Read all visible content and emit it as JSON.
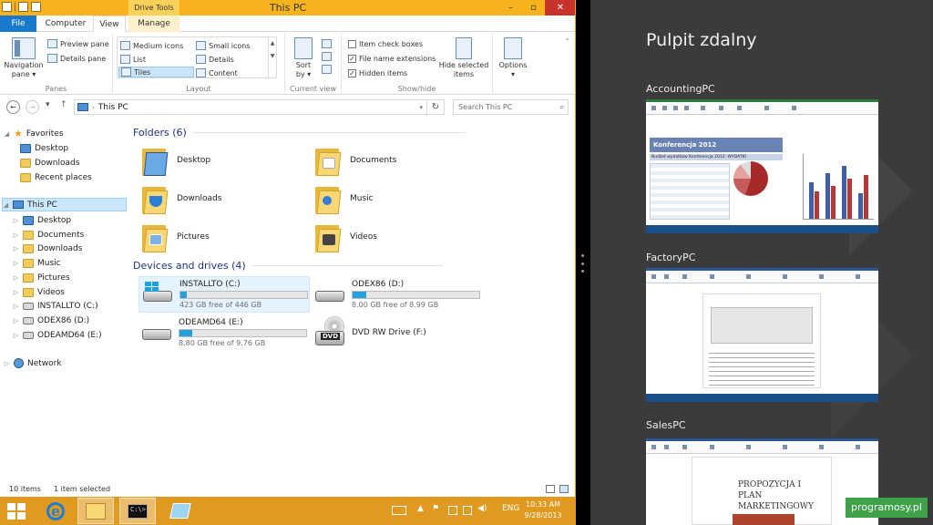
{
  "explorer": {
    "window_title": "This PC",
    "context_tab": "Drive Tools",
    "tabs": [
      {
        "label": "File"
      },
      {
        "label": "Computer"
      },
      {
        "label": "View"
      },
      {
        "label": "Manage"
      }
    ],
    "ribbon": {
      "panes": {
        "label": "Panes",
        "navigation_pane": "Navigation pane",
        "navigation_pane_line1": "Navigation",
        "navigation_pane_line2": "pane ▾",
        "preview_pane": "Preview pane",
        "details_pane": "Details pane"
      },
      "layout": {
        "label": "Layout",
        "options": [
          "Medium icons",
          "Small icons",
          "List",
          "Details",
          "Tiles",
          "Content"
        ],
        "selected": "Tiles"
      },
      "current_view": {
        "label": "Current view",
        "sort_by_line1": "Sort",
        "sort_by_line2": "by ▾"
      },
      "show_hide": {
        "label": "Show/hide",
        "item_check_boxes": "Item check boxes",
        "item_check_boxes_checked": false,
        "file_name_extensions": "File name extensions",
        "file_name_extensions_checked": true,
        "hidden_items": "Hidden items",
        "hidden_items_checked": true,
        "hide_selected_line1": "Hide selected",
        "hide_selected_line2": "items"
      },
      "options": {
        "line1": "Options",
        "line2": "▾"
      }
    },
    "address": {
      "path": "This PC",
      "search_placeholder": "Search This PC"
    },
    "nav_tree": {
      "favorites": "Favorites",
      "favorites_items": [
        "Desktop",
        "Downloads",
        "Recent places"
      ],
      "this_pc": "This PC",
      "this_pc_items": [
        "Desktop",
        "Documents",
        "Downloads",
        "Music",
        "Pictures",
        "Videos",
        "INSTALLTO (C:)",
        "ODEX86 (D:)",
        "ODEAMD64 (E:)"
      ],
      "network": "Network"
    },
    "folders": {
      "header": "Folders (6)",
      "items": [
        "Desktop",
        "Documents",
        "Downloads",
        "Music",
        "Pictures",
        "Videos"
      ]
    },
    "devices": {
      "header": "Devices and drives (4)",
      "drives": [
        {
          "name": "INSTALLTO (C:)",
          "free": "423 GB free of 446 GB",
          "used_fraction": 0.05
        },
        {
          "name": "ODEX86 (D:)",
          "free": "8.00 GB free of 8.99 GB",
          "used_fraction": 0.11
        },
        {
          "name": "ODEAMD64 (E:)",
          "free": "8.80 GB free of 9.76 GB",
          "used_fraction": 0.1
        },
        {
          "name": "DVD RW Drive (F:)"
        }
      ],
      "dvd_label": "DVD"
    },
    "status": {
      "items": "10 items",
      "selected": "1 item selected"
    }
  },
  "taskbar": {
    "language": "ENG",
    "time": "10:33 AM",
    "date": "9/28/2013",
    "cmd_text": "C:\\>"
  },
  "remote_panel": {
    "title": "Pulpit zdalny",
    "pcs": [
      {
        "name": "AccountingPC",
        "preview_heading": "Konferencja 2012",
        "preview_sub": "Budżet wydatków Konferencja 2012: WYDATKI"
      },
      {
        "name": "FactoryPC"
      },
      {
        "name": "SalesPC",
        "preview_line1": "PROPOZYCJA I",
        "preview_line2": "PLAN",
        "preview_line3": "MARKETINGOWY"
      }
    ]
  },
  "watermark": "programosy.pl",
  "colors": {
    "titlebar": "#f6b31e",
    "taskbar": "#e09a1f",
    "file_tab": "#1979ca",
    "drive_bar": "#26a0da",
    "group_header": "#1e3287",
    "close": "#c7332a",
    "remote_bg": "#3b3b3b",
    "watermark": "#3fa14a"
  }
}
